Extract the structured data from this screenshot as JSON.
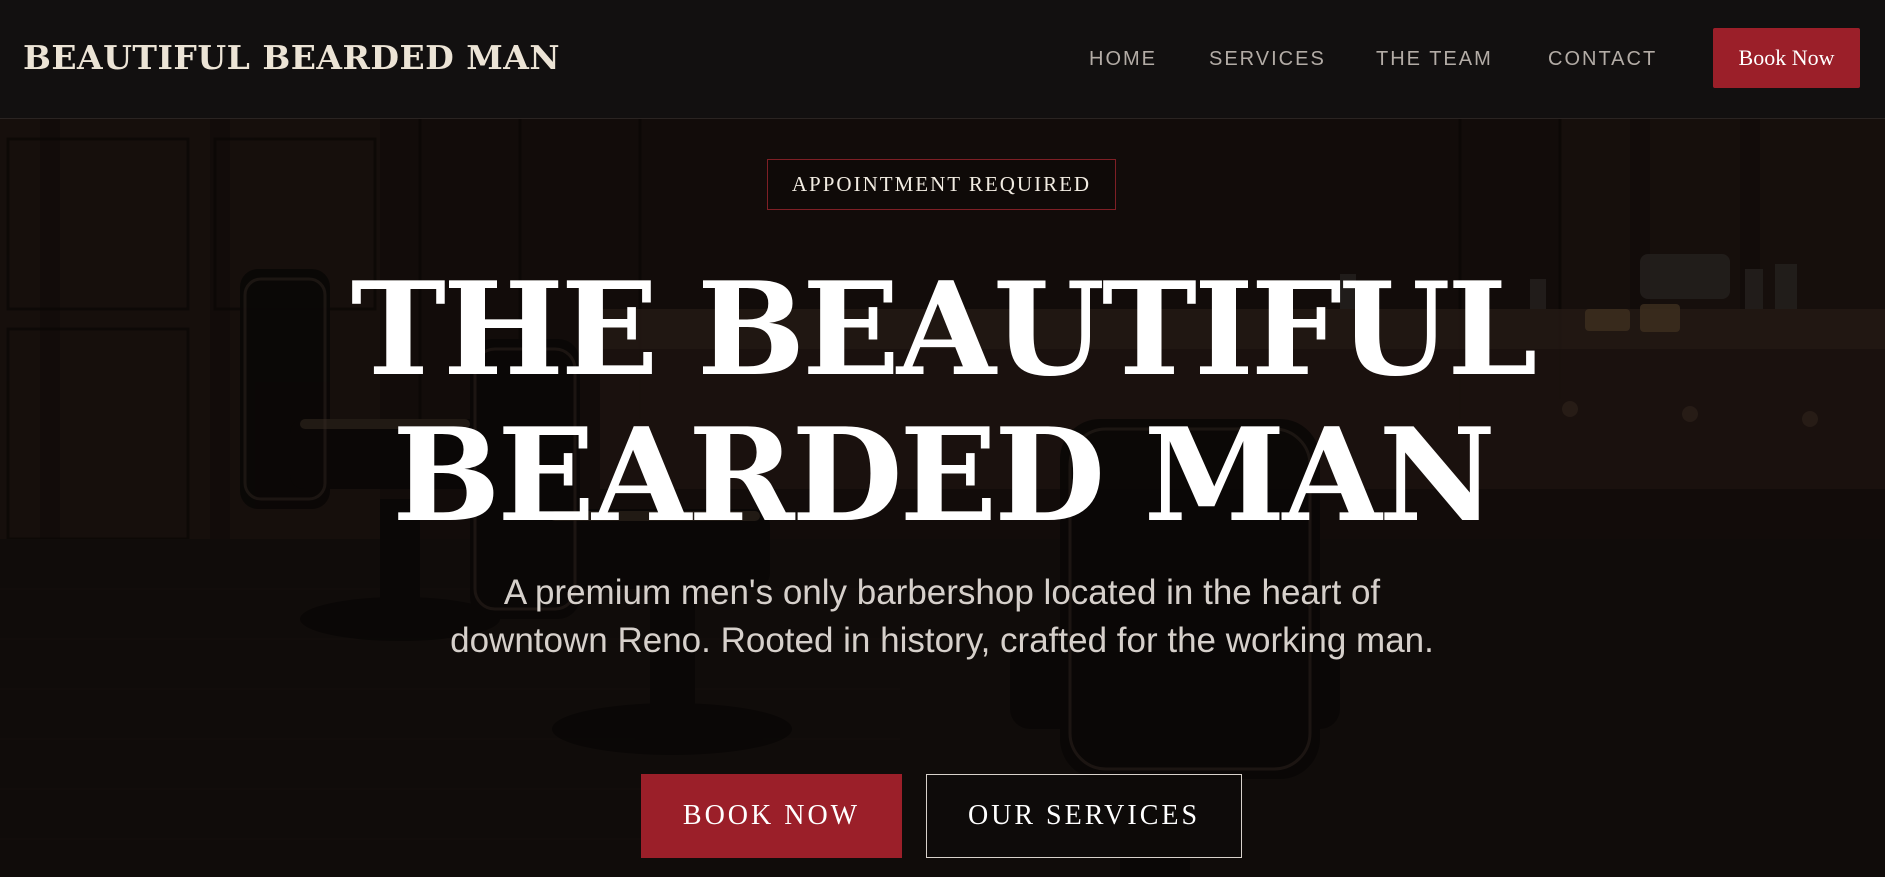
{
  "brand": {
    "name": "BEAUTIFUL BEARDED MAN",
    "accent_color": "#9b1f29",
    "header_bg": "#121010"
  },
  "nav": {
    "items": [
      {
        "label": "HOME"
      },
      {
        "label": "SERVICES"
      },
      {
        "label": "THE TEAM"
      },
      {
        "label": "CONTACT"
      }
    ],
    "book_label": "Book Now"
  },
  "hero": {
    "badge": "APPOINTMENT REQUIRED",
    "title_line1": "THE BEAUTIFUL",
    "title_line2": "BEARDED MAN",
    "subtitle": "A premium men's only barbershop located in the heart of downtown Reno. Rooted in history, crafted for the working man.",
    "primary_cta": "BOOK NOW",
    "secondary_cta": "OUR SERVICES"
  }
}
